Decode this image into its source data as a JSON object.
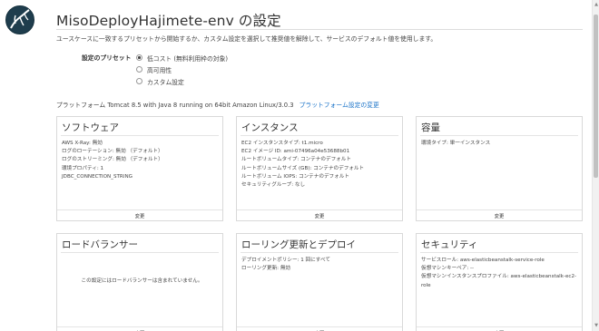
{
  "header": {
    "title": "MisoDeployHajimete-env の設定",
    "intro": "ユースケースに一致するプリセットから開始するか、カスタム設定を選択して推奨値を解除して、サービスのデフォルト値を使用します。"
  },
  "preset": {
    "label": "設定のプリセット",
    "options": [
      {
        "label": "低コスト (無料利用枠の対象)",
        "selected": true
      },
      {
        "label": "高可用性",
        "selected": false
      },
      {
        "label": "カスタム設定",
        "selected": false
      }
    ]
  },
  "platform": {
    "text": "プラットフォーム Tomcat 8.5 with Java 8 running on 64bit Amazon Linux/3.0.3",
    "link": "プラットフォーム設定の変更"
  },
  "cards": [
    {
      "title": "ソフトウェア",
      "lines": [
        "AWS X-Ray: 無効",
        "ログのローテーション: 無効 （デフォルト）",
        "ログのストリーミング: 無効 （デフォルト）",
        "環境プロパティ: 1",
        "JDBC_CONNECTION_STRING"
      ],
      "button": "変更"
    },
    {
      "title": "インスタンス",
      "lines": [
        "EC2 インスタンスタイプ: t1.micro",
        "EC2 イメージ ID: ami-07496a04e53688b01",
        "ルートボリュームタイプ: コンテナのデフォルト",
        "ルートボリュームサイズ (GB): コンテナのデフォルト",
        "ルートボリューム IOPS: コンテナのデフォルト",
        "セキュリティグループ: なし"
      ],
      "button": "変更"
    },
    {
      "title": "容量",
      "lines": [
        "環境タイプ: 単一インスタンス"
      ],
      "button": "変更"
    },
    {
      "title": "ロードバランサー",
      "center": "この設定にはロードバランサーは含まれていません。",
      "button": "変更"
    },
    {
      "title": "ローリング更新とデプロイ",
      "lines": [
        "デプロイメントポリシー: 1 回にすべて",
        "ローリング更新: 無効"
      ],
      "button": "変更"
    },
    {
      "title": "セキュリティ",
      "lines": [
        "サービスロール: aws-elasticbeanstalk-service-role",
        "仮想マシンキーペア: --",
        "仮想マシンインスタンスプロファイル: aws-elasticbeanstalk-ec2-role"
      ],
      "button": "変更"
    }
  ],
  "icons": {
    "logo": "elastic-beanstalk-logo",
    "radio": "radio-button"
  },
  "colors": {
    "link": "#1a73c8",
    "border": "#d9d9d9",
    "logo": "#1f3d4d"
  }
}
